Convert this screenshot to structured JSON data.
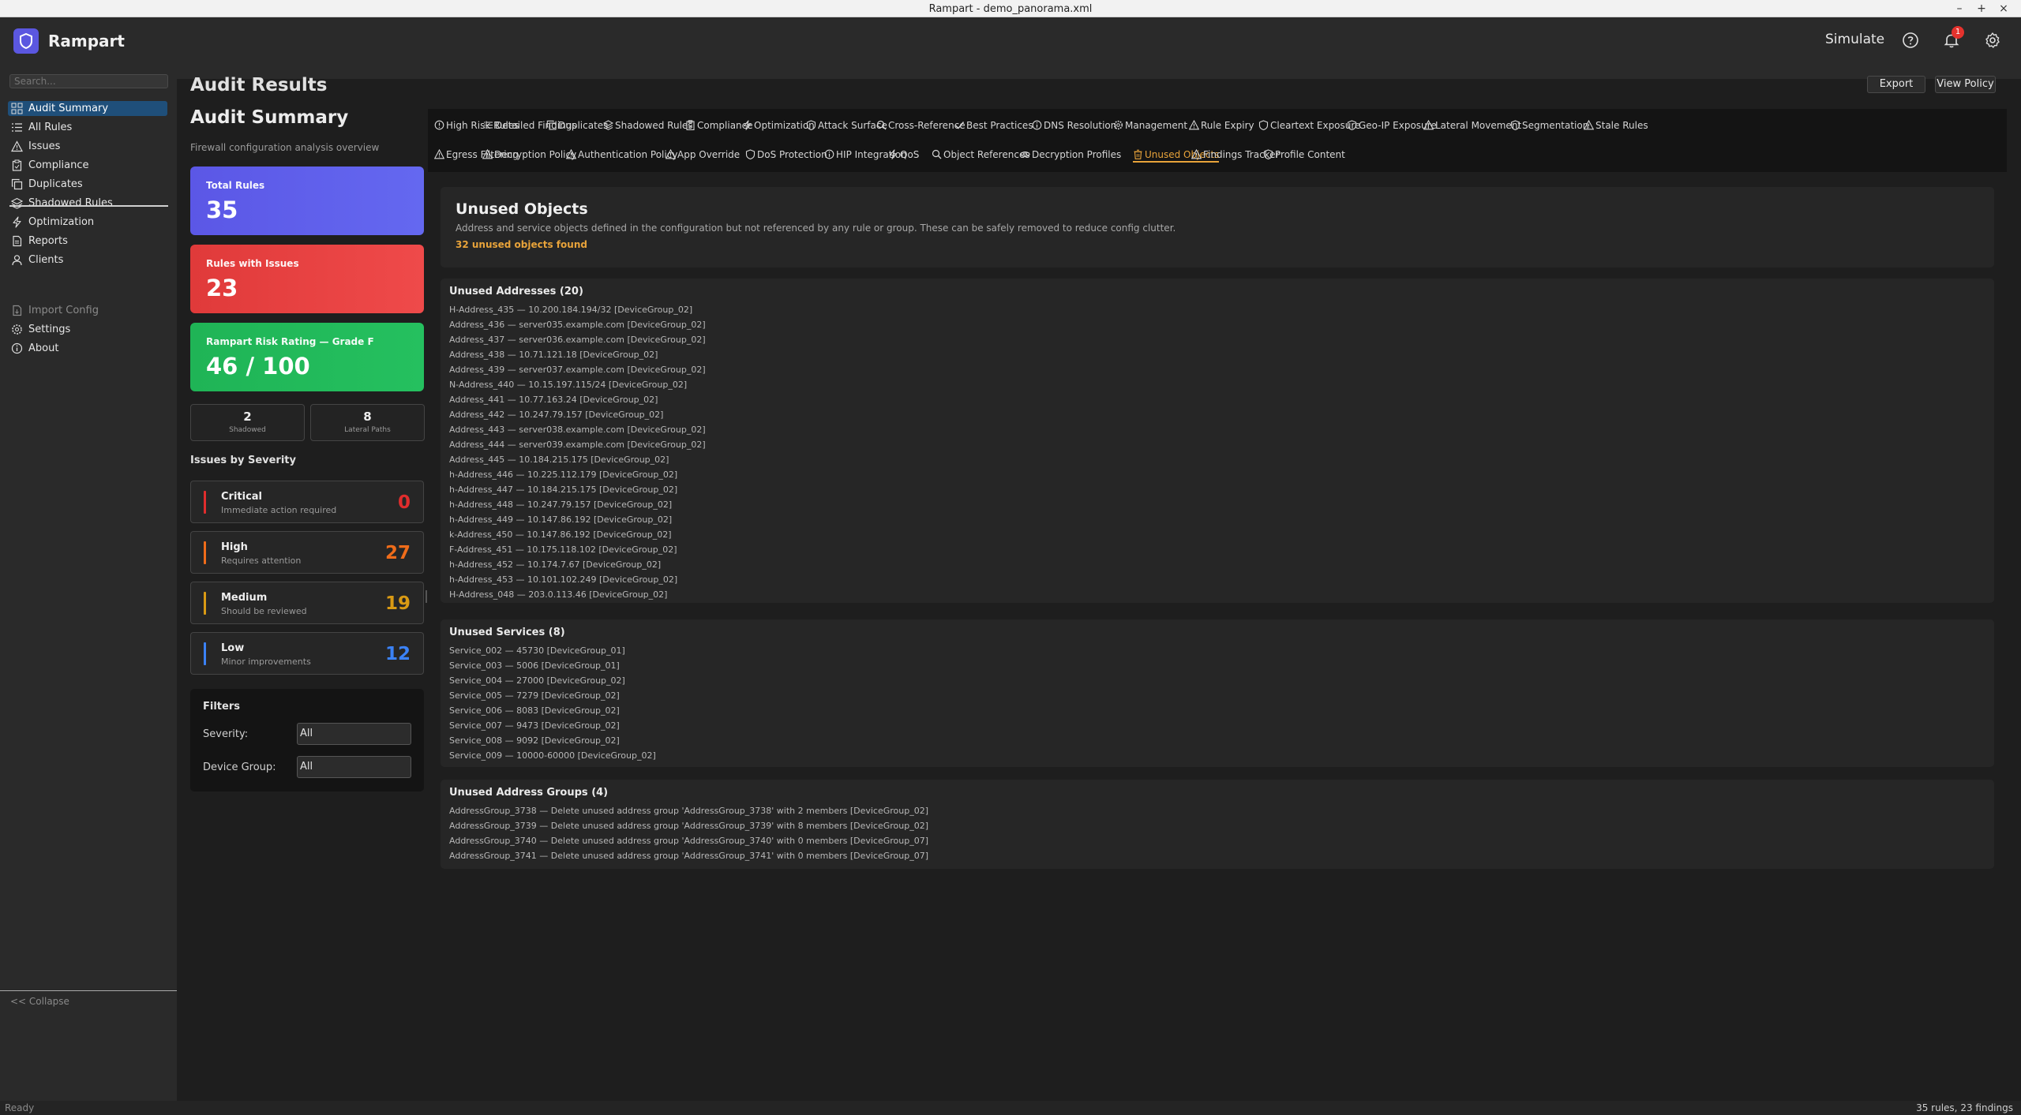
{
  "window": {
    "title": "Rampart - demo_panorama.xml",
    "minimize": "–",
    "maximize": "+",
    "close": "×"
  },
  "header": {
    "brand": "Rampart",
    "simulate_label": "Simulate",
    "notification_count": "1"
  },
  "sidebar": {
    "search_placeholder": "Search...",
    "items": [
      {
        "label": "Audit Summary",
        "icon": "dashboard-icon"
      },
      {
        "label": "All Rules",
        "icon": "list-icon"
      },
      {
        "label": "Issues",
        "icon": "warning-icon"
      },
      {
        "label": "Compliance",
        "icon": "clipboard-icon"
      },
      {
        "label": "Duplicates",
        "icon": "copy-icon"
      },
      {
        "label": "Shadowed Rules",
        "icon": "layers-icon"
      },
      {
        "label": "Optimization",
        "icon": "bolt-icon"
      },
      {
        "label": "Reports",
        "icon": "file-icon"
      },
      {
        "label": "Clients",
        "icon": "user-icon"
      }
    ],
    "secondary": [
      {
        "label": "Import Config",
        "icon": "import-icon"
      },
      {
        "label": "Settings",
        "icon": "gear-icon"
      },
      {
        "label": "About",
        "icon": "info-icon"
      }
    ],
    "collapse_label": "<< Collapse"
  },
  "main": {
    "page_title": "Audit Results",
    "export_label": "Export",
    "view_policy_label": "View Policy"
  },
  "summary": {
    "title": "Audit Summary",
    "subtitle": "Firewall configuration analysis overview",
    "total_rules_label": "Total Rules",
    "total_rules_value": "35",
    "rules_with_issues_label": "Rules with Issues",
    "rules_with_issues_value": "23",
    "risk_label": "Rampart Risk Rating — Grade F",
    "risk_value": "46 / 100",
    "shadowed_value": "2",
    "shadowed_label": "Shadowed",
    "lateral_value": "8",
    "lateral_label": "Lateral Paths",
    "severity_heading": "Issues by Severity",
    "severities": [
      {
        "name": "Critical",
        "desc": "Immediate action required",
        "count": "0",
        "color": "#e02d2d"
      },
      {
        "name": "High",
        "desc": "Requires attention",
        "count": "27",
        "color": "#ef6c1a"
      },
      {
        "name": "Medium",
        "desc": "Should be reviewed",
        "count": "19",
        "color": "#d99a14"
      },
      {
        "name": "Low",
        "desc": "Minor improvements",
        "count": "12",
        "color": "#3b82f6"
      }
    ],
    "filters": {
      "title": "Filters",
      "severity_label": "Severity:",
      "severity_value": "All",
      "device_group_label": "Device Group:",
      "device_group_value": "All"
    }
  },
  "tabs_row1": [
    {
      "label": "High Risk Rules",
      "icon": "alert-circle-icon"
    },
    {
      "label": "Detailed Findings",
      "icon": "list-icon"
    },
    {
      "label": "Duplicates",
      "icon": "copy-icon"
    },
    {
      "label": "Shadowed Rules",
      "icon": "layers-icon"
    },
    {
      "label": "Compliance",
      "icon": "clipboard-icon"
    },
    {
      "label": "Optimization",
      "icon": "bolt-icon"
    },
    {
      "label": "Attack Surface",
      "icon": "shield-icon"
    },
    {
      "label": "Cross-Reference",
      "icon": "search-icon"
    },
    {
      "label": "Best Practices",
      "icon": "check-icon"
    },
    {
      "label": "DNS Resolution",
      "icon": "info-icon"
    },
    {
      "label": "Management",
      "icon": "gear-icon"
    },
    {
      "label": "Rule Expiry",
      "icon": "warning-icon"
    },
    {
      "label": "Cleartext Exposure",
      "icon": "shield-icon"
    },
    {
      "label": "Geo-IP Exposure",
      "icon": "shield-icon"
    },
    {
      "label": "Lateral Movement",
      "icon": "warning-icon"
    },
    {
      "label": "Segmentation",
      "icon": "shield-icon"
    },
    {
      "label": "Stale Rules",
      "icon": "warning-icon"
    }
  ],
  "tabs_row2": [
    {
      "label": "Egress Filtering",
      "icon": "warning-icon"
    },
    {
      "label": "Decryption Policy",
      "icon": "warning-icon"
    },
    {
      "label": "Authentication Policy",
      "icon": "warning-icon"
    },
    {
      "label": "App Override",
      "icon": "warning-icon"
    },
    {
      "label": "DoS Protection",
      "icon": "shield-icon"
    },
    {
      "label": "HIP Integration",
      "icon": "info-icon"
    },
    {
      "label": "QoS",
      "icon": "bolt-icon"
    },
    {
      "label": "Object References",
      "icon": "search-icon"
    },
    {
      "label": "Decryption Profiles",
      "icon": "eye-icon"
    },
    {
      "label": "Unused Objects",
      "icon": "trash-icon",
      "active": true
    },
    {
      "label": "Findings Tracker",
      "icon": "warning-icon"
    },
    {
      "label": "Profile Content",
      "icon": "shield-icon"
    }
  ],
  "unused": {
    "title": "Unused Objects",
    "description": "Address and service objects defined in the configuration but not referenced by any rule or group. These can be safely removed to reduce config clutter.",
    "count_text": "32 unused objects found",
    "addresses_title": "Unused Addresses (20)",
    "addresses": [
      "H-Address_435  —  10.200.184.194/32  [DeviceGroup_02]",
      "Address_436  —  server035.example.com  [DeviceGroup_02]",
      "Address_437  —  server036.example.com  [DeviceGroup_02]",
      "Address_438  —  10.71.121.18  [DeviceGroup_02]",
      "Address_439  —  server037.example.com  [DeviceGroup_02]",
      "N-Address_440  —  10.15.197.115/24  [DeviceGroup_02]",
      "Address_441  —  10.77.163.24  [DeviceGroup_02]",
      "Address_442  —  10.247.79.157  [DeviceGroup_02]",
      "Address_443  —  server038.example.com  [DeviceGroup_02]",
      "Address_444  —  server039.example.com  [DeviceGroup_02]",
      "Address_445  —  10.184.215.175  [DeviceGroup_02]",
      "h-Address_446  —  10.225.112.179  [DeviceGroup_02]",
      "h-Address_447  —  10.184.215.175  [DeviceGroup_02]",
      "h-Address_448  —  10.247.79.157  [DeviceGroup_02]",
      "h-Address_449  —  10.147.86.192  [DeviceGroup_02]",
      "k-Address_450  —  10.147.86.192  [DeviceGroup_02]",
      "F-Address_451  —  10.175.118.102  [DeviceGroup_02]",
      "h-Address_452  —  10.174.7.67  [DeviceGroup_02]",
      "h-Address_453  —  10.101.102.249  [DeviceGroup_02]",
      "H-Address_048  —  203.0.113.46  [DeviceGroup_02]"
    ],
    "services_title": "Unused Services (8)",
    "services": [
      "Service_002  —  45730  [DeviceGroup_01]",
      "Service_003  —  5006  [DeviceGroup_01]",
      "Service_004  —  27000  [DeviceGroup_02]",
      "Service_005  —  7279  [DeviceGroup_02]",
      "Service_006  —  8083  [DeviceGroup_02]",
      "Service_007  —  9473  [DeviceGroup_02]",
      "Service_008  —  9092  [DeviceGroup_02]",
      "Service_009  —  10000-60000  [DeviceGroup_02]"
    ],
    "groups_title": "Unused Address Groups (4)",
    "groups": [
      "AddressGroup_3738  —  Delete unused address group 'AddressGroup_3738' with 2 members  [DeviceGroup_02]",
      "AddressGroup_3739  —  Delete unused address group 'AddressGroup_3739' with 8 members  [DeviceGroup_02]",
      "AddressGroup_3740  —  Delete unused address group 'AddressGroup_3740' with 0 members  [DeviceGroup_07]",
      "AddressGroup_3741  —  Delete unused address group 'AddressGroup_3741' with 0 members  [DeviceGroup_07]"
    ]
  },
  "status": {
    "left": "Ready",
    "right": "35 rules, 23 findings"
  },
  "colors": {
    "accent": "#e8a33a",
    "active_nav": "#1f4f7a",
    "total_rules_card": "#5b57e6",
    "issues_card": "#e03a3a",
    "risk_card": "#1fb456"
  }
}
